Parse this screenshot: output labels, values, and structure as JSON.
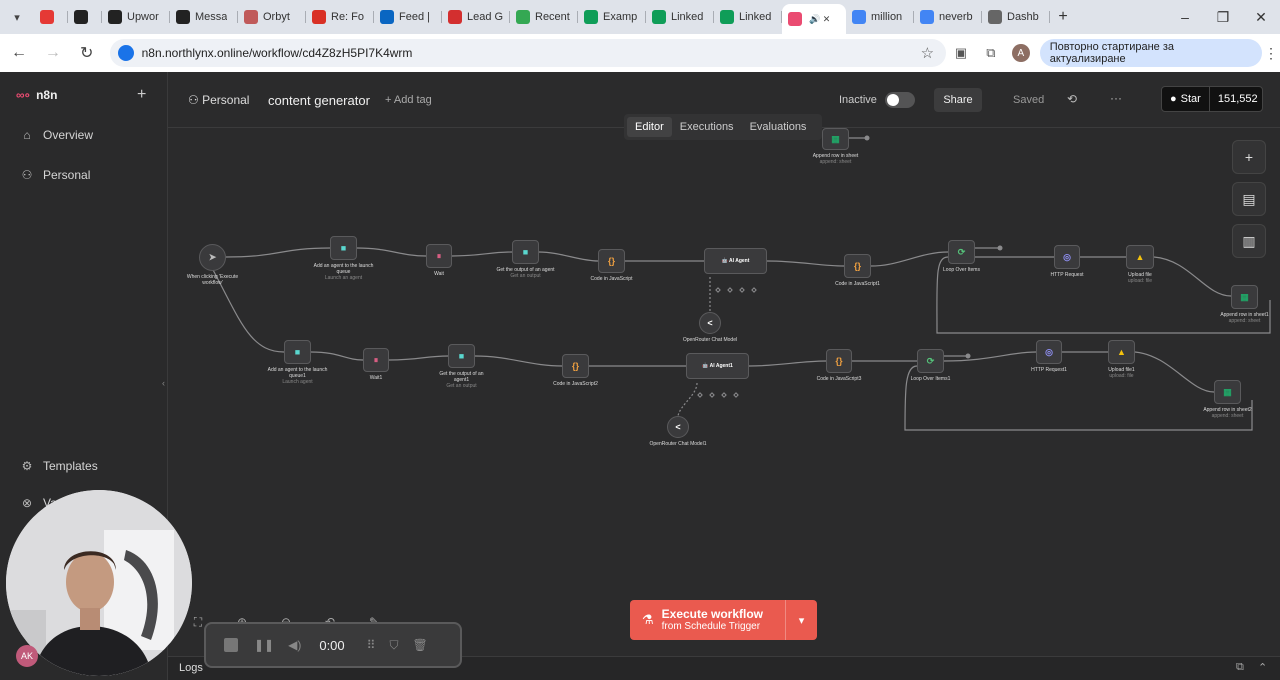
{
  "browser": {
    "tabs": [
      {
        "label": "",
        "icon": "opera-icon",
        "color": "#e53935",
        "small": true
      },
      {
        "label": "",
        "icon": "upwork-icon",
        "color": "#222222",
        "small": true
      },
      {
        "label": "Upwor",
        "icon": "upwork-icon",
        "color": "#222222"
      },
      {
        "label": "Messa",
        "icon": "upwork-icon",
        "color": "#222222"
      },
      {
        "label": "Orbyt",
        "icon": "orbyt-icon",
        "color": "#c05a5a"
      },
      {
        "label": "Re: Fo",
        "icon": "gmail-icon",
        "color": "#d93025"
      },
      {
        "label": "Feed |",
        "icon": "linkedin-icon",
        "color": "#0a66c2"
      },
      {
        "label": "Lead G",
        "icon": "sk-icon",
        "color": "#d32f2f"
      },
      {
        "label": "Recent",
        "icon": "drive-icon",
        "color": "#34a853"
      },
      {
        "label": "Examp",
        "icon": "sheets-icon",
        "color": "#0f9d58"
      },
      {
        "label": "Linked",
        "icon": "sheets-icon",
        "color": "#0f9d58"
      },
      {
        "label": "Linked",
        "icon": "sheets-icon",
        "color": "#0f9d58"
      },
      {
        "label": "",
        "icon": "n8n-icon",
        "color": "#ea4b71",
        "active": true
      },
      {
        "label": "million",
        "icon": "google-icon",
        "color": "#4285f4"
      },
      {
        "label": "neverb",
        "icon": "google-icon",
        "color": "#4285f4"
      },
      {
        "label": "Dashb",
        "icon": "dashboard-icon",
        "color": "#666666"
      }
    ],
    "url": "n8n.northlynx.online/workflow/cd4Z8zH5PI7K4wrm",
    "profile_initial": "A",
    "update_label": "Повторно стартиране за актуализиране"
  },
  "sidebar": {
    "brand": "n8n",
    "items": [
      {
        "label": "Overview",
        "icon": "home-icon"
      },
      {
        "label": "Personal",
        "icon": "user-icon"
      },
      {
        "label": "Templates",
        "icon": "templates-icon"
      },
      {
        "label": "Va",
        "icon": "variables-icon"
      }
    ],
    "user_initials": "AK"
  },
  "header": {
    "project": "Personal",
    "workflow_name": "content generator",
    "add_tag": "+ Add tag",
    "status": "Inactive",
    "share": "Share",
    "saved": "Saved",
    "github_star": "Star",
    "github_count": "151,552",
    "tabs": [
      "Editor",
      "Executions",
      "Evaluations"
    ]
  },
  "canvas": {
    "nodes": {
      "trigger": {
        "label": "When clicking 'Execute workflow'"
      },
      "agent_a": {
        "label": "Add an agent to the launch queue",
        "sub": "Launch an agent"
      },
      "wait_a": {
        "label": "Wait"
      },
      "get_a": {
        "label": "Get the output of an agent",
        "sub": "Get an output"
      },
      "code_a": {
        "label": "Code in JavaScript"
      },
      "ai_a": {
        "label": "AI Agent"
      },
      "model_a": {
        "label": "OpenRouter Chat Model"
      },
      "code_a2": {
        "label": "Code in JavaScript1"
      },
      "loop_a": {
        "label": "Loop Over Items"
      },
      "http_a": {
        "label": "HTTP Request"
      },
      "upload_a": {
        "label": "Upload file",
        "sub": "upload: file"
      },
      "append_a": {
        "label": "Append row in sheet1",
        "sub": "append: sheet"
      },
      "append_top": {
        "label": "Append row in sheet",
        "sub": "append: sheet"
      },
      "agent_b": {
        "label": "Add an agent to the launch queue1",
        "sub": "Launch agent"
      },
      "wait_b": {
        "label": "Wait1"
      },
      "get_b": {
        "label": "Get the output of an agent1",
        "sub": "Get an output"
      },
      "code_b": {
        "label": "Code in JavaScript2"
      },
      "ai_b": {
        "label": "AI Agent1"
      },
      "model_b": {
        "label": "OpenRouter Chat Model1"
      },
      "code_b2": {
        "label": "Code in JavaScript3"
      },
      "loop_b": {
        "label": "Loop Over Items1"
      },
      "http_b": {
        "label": "HTTP Request1"
      },
      "upload_b": {
        "label": "Upload file1",
        "sub": "upload: file"
      },
      "append_b": {
        "label": "Append row in sheet2",
        "sub": "append: sheet"
      }
    }
  },
  "execute": {
    "line1": "Execute workflow",
    "line2": "from Schedule Trigger"
  },
  "recorder": {
    "time": "0:00"
  },
  "logs": {
    "label": "Logs"
  },
  "colors": {
    "accent": "#ea4b71",
    "execute": "#ea5a4f",
    "canvas": "#2b2b2c"
  }
}
